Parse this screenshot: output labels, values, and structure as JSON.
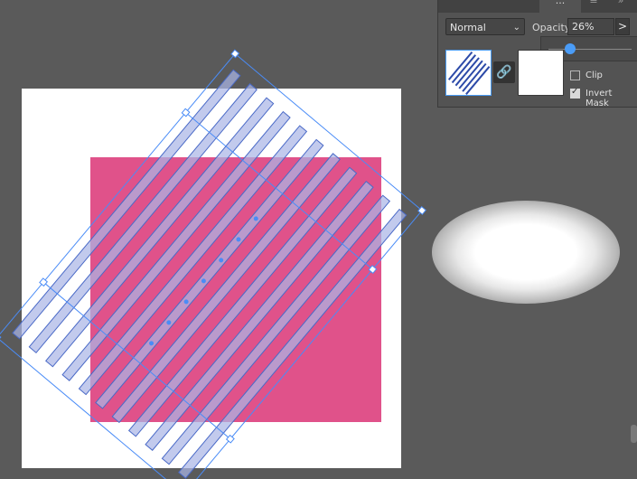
{
  "panel": {
    "tabs": [
      {
        "label": "...",
        "active": true
      },
      {
        "label": "≡",
        "active": false
      },
      {
        "label": "»",
        "active": false
      }
    ],
    "blend_mode": "Normal",
    "opacity_label": "Opacity:",
    "opacity_value": "26%",
    "opacity_fraction": 0.26,
    "opacity_arrow": ">",
    "link_icon": "link-icon",
    "clip_label": "Clip",
    "clip_checked": false,
    "invert_label": "Invert Mask",
    "invert_checked": true
  },
  "colors": {
    "canvas_bg": "#5a5a5a",
    "artboard": "#ffffff",
    "pink_rect": "#e0528a",
    "stripe_fill": "#aab6e6",
    "selection": "#4a8cf7"
  }
}
